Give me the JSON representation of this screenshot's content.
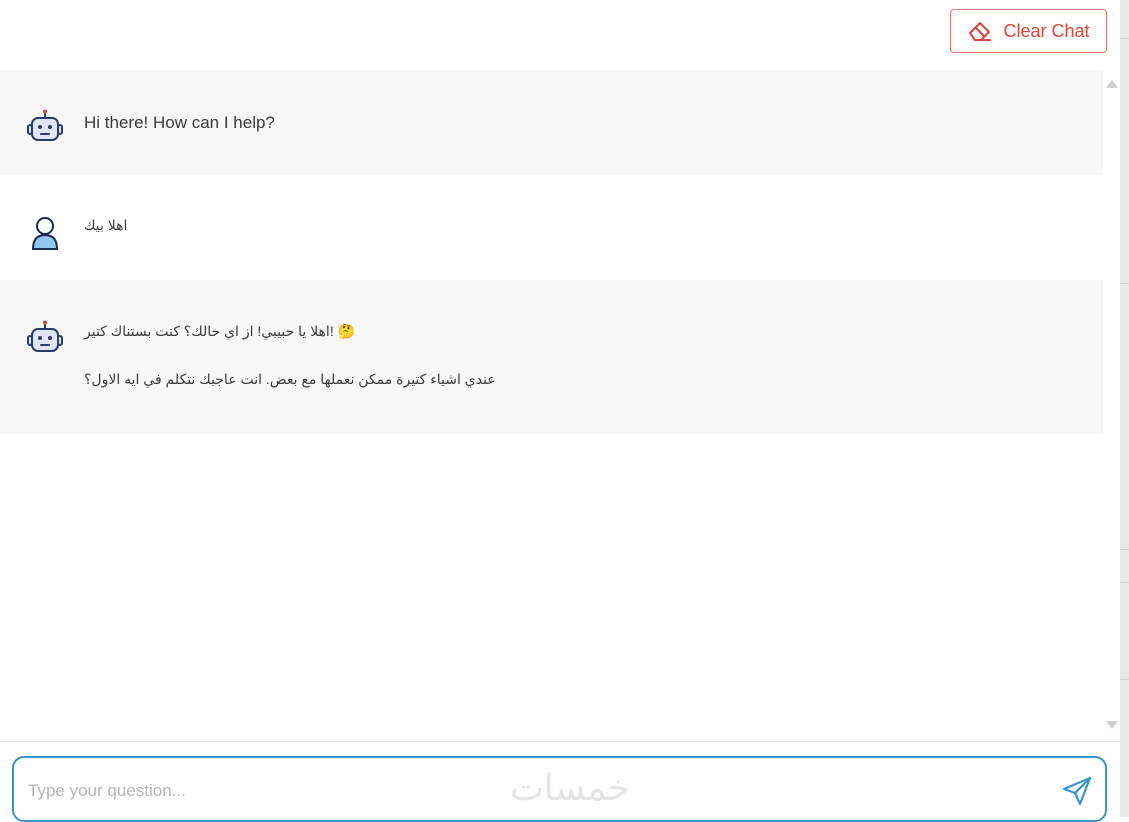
{
  "header": {
    "clear_label": "Clear Chat"
  },
  "messages": [
    {
      "role": "bot",
      "lines": [
        "Hi there! How can I help?"
      ]
    },
    {
      "role": "user",
      "lines": [
        "اهلا بيك"
      ]
    },
    {
      "role": "bot",
      "lines": [
        "🤔 !اهلا يا حبيبي! از اي حالك؟ كنت بستناك كتير",
        "عندي اشياء كتيرة ممكن نعملها مع بعض. انت عاجبك نتكلم في ايه الاول؟"
      ]
    }
  ],
  "input": {
    "placeholder": "Type your question...",
    "watermark": "خمسات"
  },
  "colors": {
    "accent": "#3a93c9",
    "clear": "#d9463a",
    "bot_bg": "#f7f7f7"
  },
  "icons": {
    "clear": "eraser-icon",
    "bot": "robot-icon",
    "user": "user-icon",
    "send": "send-icon"
  }
}
